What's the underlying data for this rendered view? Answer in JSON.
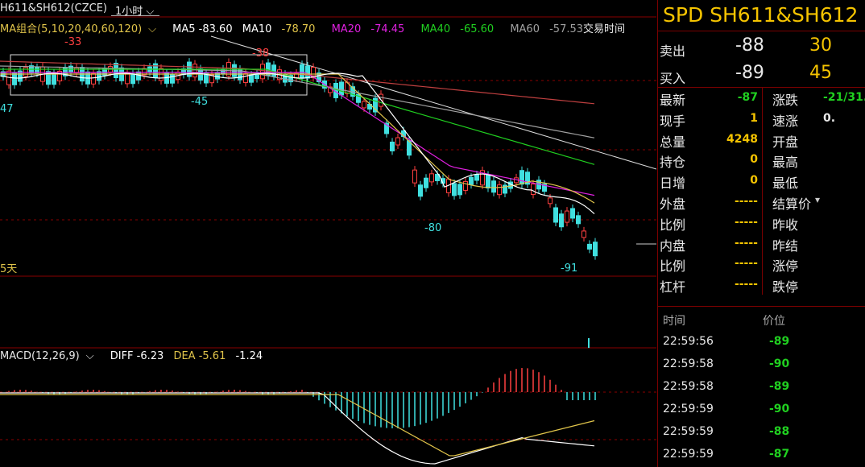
{
  "topbar": {
    "symbol": "H611&SH612(CZCE)",
    "period": "1小时",
    "period_arrow": "⌵"
  },
  "ma_legend": {
    "group": "MA组合(5,10,20,40,60,120)",
    "group_arrow": "⌵",
    "items": [
      {
        "label": "MA5 -83.60",
        "color": "#ffffff"
      },
      {
        "label": "MA10",
        "value": "-78.70",
        "color": "#e0c44a"
      },
      {
        "label": "MA20",
        "value": "-74.45",
        "color": "#e020e0"
      },
      {
        "label": "MA40",
        "value": "-65.60",
        "color": "#20d020"
      },
      {
        "label": "MA60",
        "value": "-57.53",
        "color": "#a0a0a0"
      }
    ]
  },
  "trade_time": "交易时间",
  "days_label": "5天",
  "price_annotations": [
    {
      "text": "-33",
      "color": "#ff4040"
    },
    {
      "text": "-38",
      "color": "#ff4040"
    },
    {
      "text": "-45",
      "color": "#40e0e0"
    },
    {
      "text": "47",
      "color": "#40e0e0"
    },
    {
      "text": "-80",
      "color": "#40e0e0"
    },
    {
      "text": "-91",
      "color": "#40e0e0"
    }
  ],
  "macd_legend": {
    "name": "MACD(12,26,9)",
    "arrow": "⌵",
    "diff": "DIFF -6.23",
    "dea": "DEA -5.61",
    "macd": "-1.24"
  },
  "chart_colors": {
    "up": "#ff4040",
    "down": "#40e0e0",
    "grid": "#8a0000",
    "ma5": "#ffffff",
    "ma10": "#e0c44a",
    "ma20": "#e020e0",
    "ma40": "#20d020",
    "ma60": "#a0a0a0",
    "ma120": "#c04040"
  },
  "panel": {
    "title": "SPD SH611&SH612",
    "sell": {
      "label": "卖出",
      "price": "-88",
      "qty": "30"
    },
    "buy": {
      "label": "买入",
      "price": "-89",
      "qty": "45"
    },
    "stats_left": [
      {
        "label": "最新",
        "value": "-87",
        "color": "#20d020"
      },
      {
        "label": "现手",
        "value": "1",
        "color": "#f5c400"
      },
      {
        "label": "总量",
        "value": "4248",
        "color": "#f5c400"
      },
      {
        "label": "持仓",
        "value": "0",
        "color": "#f5c400"
      },
      {
        "label": "日增",
        "value": "0",
        "color": "#f5c400"
      },
      {
        "label": "外盘",
        "value": "-----",
        "color": "#f5c400"
      },
      {
        "label": "比例",
        "value": "-----",
        "color": "#f5c400"
      },
      {
        "label": "内盘",
        "value": "-----",
        "color": "#f5c400"
      },
      {
        "label": "比例",
        "value": "-----",
        "color": "#f5c400"
      },
      {
        "label": "杠杆",
        "value": "-----",
        "color": "#f5c400"
      }
    ],
    "stats_right": [
      {
        "label": "涨跌",
        "value": "-21/31.",
        "color": "#20d020"
      },
      {
        "label": "速涨",
        "value": "0.",
        "color": "#e8e8e8"
      },
      {
        "label": "开盘",
        "value": "",
        "color": "#e8e8e8"
      },
      {
        "label": "最高",
        "value": "",
        "color": "#e8e8e8"
      },
      {
        "label": "最低",
        "value": "",
        "color": "#e8e8e8"
      },
      {
        "label": "结算价",
        "value": "",
        "color": "#e8e8e8"
      },
      {
        "label": "昨收",
        "value": "",
        "color": "#e8e8e8"
      },
      {
        "label": "昨结",
        "value": "",
        "color": "#e8e8e8"
      },
      {
        "label": "涨停",
        "value": "",
        "color": "#e8e8e8"
      },
      {
        "label": "跌停",
        "value": "",
        "color": "#e8e8e8"
      }
    ],
    "settle_arrow": "▾",
    "ticks_header": {
      "time": "时间",
      "price": "价位"
    },
    "ticks": [
      {
        "time": "22:59:56",
        "price": "-89"
      },
      {
        "time": "22:59:58",
        "price": "-90"
      },
      {
        "time": "22:59:58",
        "price": "-89"
      },
      {
        "time": "22:59:59",
        "price": "-90"
      },
      {
        "time": "22:59:59",
        "price": "-88"
      },
      {
        "time": "22:59:59",
        "price": "-87"
      }
    ]
  }
}
